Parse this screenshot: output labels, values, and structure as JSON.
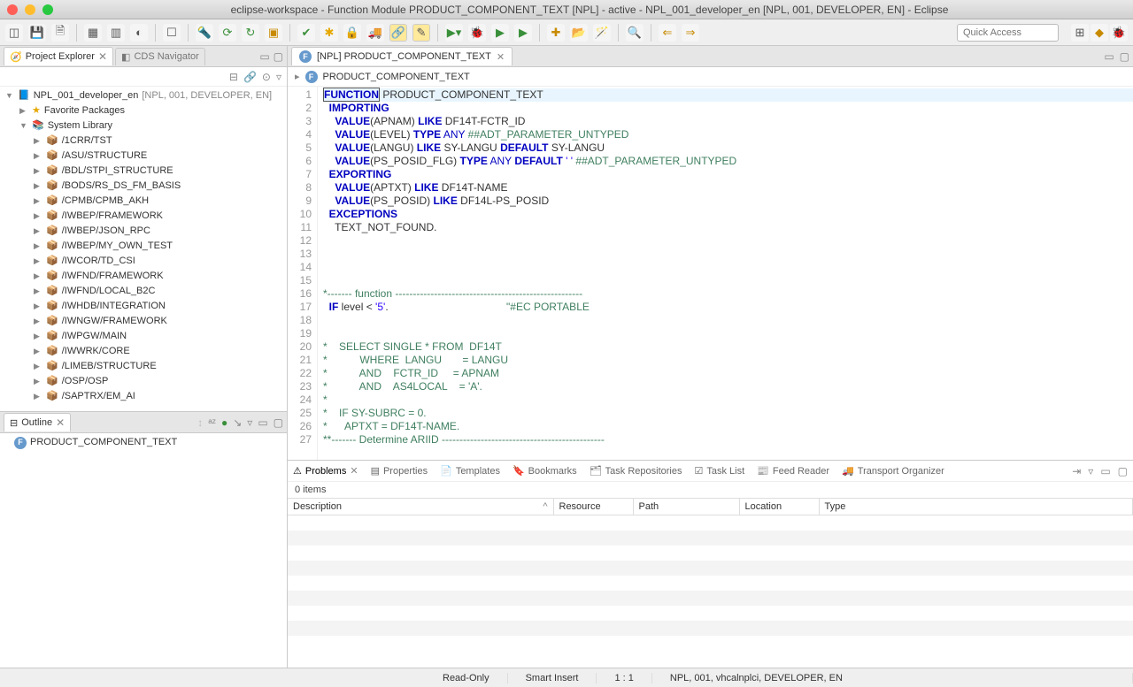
{
  "window_title": "eclipse-workspace - Function Module PRODUCT_COMPONENT_TEXT [NPL] - active - NPL_001_developer_en [NPL, 001, DEVELOPER, EN] - Eclipse",
  "quick_access_placeholder": "Quick Access",
  "views": {
    "project_explorer": "Project Explorer",
    "cds_navigator": "CDS Navigator",
    "outline": "Outline"
  },
  "tree": {
    "root": "NPL_001_developer_en",
    "root_suffix": "[NPL, 001, DEVELOPER, EN]",
    "favorite": "Favorite Packages",
    "syslib": "System Library",
    "packages": [
      "/1CRR/TST",
      "/ASU/STRUCTURE",
      "/BDL/STPI_STRUCTURE",
      "/BODS/RS_DS_FM_BASIS",
      "/CPMB/CPMB_AKH",
      "/IWBEP/FRAMEWORK",
      "/IWBEP/JSON_RPC",
      "/IWBEP/MY_OWN_TEST",
      "/IWCOR/TD_CSI",
      "/IWFND/FRAMEWORK",
      "/IWFND/LOCAL_B2C",
      "/IWHDB/INTEGRATION",
      "/IWNGW/FRAMEWORK",
      "/IWPGW/MAIN",
      "/IWWRK/CORE",
      "/LIMEB/STRUCTURE",
      "/OSP/OSP",
      "/SAPTRX/EM_AI"
    ]
  },
  "outline_item": "PRODUCT_COMPONENT_TEXT",
  "editor": {
    "tab": "[NPL] PRODUCT_COMPONENT_TEXT",
    "breadcrumb": "PRODUCT_COMPONENT_TEXT",
    "lines": [
      {
        "n": 1,
        "html": "<span class='hl'><span class='kw'>FUNCTION</span></span> PRODUCT_COMPONENT_TEXT"
      },
      {
        "n": 2,
        "html": "  <span class='kw'>IMPORTING</span>"
      },
      {
        "n": 3,
        "html": "    <span class='kw'>VALUE</span>(APNAM) <span class='kw'>LIKE</span> DF14T-FCTR_ID"
      },
      {
        "n": 4,
        "html": "    <span class='kw'>VALUE</span>(LEVEL) <span class='kw'>TYPE</span> <span class='ty'>ANY</span> <span class='cmt'>##ADT_PARAMETER_UNTYPED</span>"
      },
      {
        "n": 5,
        "html": "    <span class='kw'>VALUE</span>(LANGU) <span class='kw'>LIKE</span> SY-LANGU <span class='kw'>DEFAULT</span> SY-LANGU"
      },
      {
        "n": 6,
        "html": "    <span class='kw'>VALUE</span>(PS_POSID_FLG) <span class='kw'>TYPE</span> <span class='ty'>ANY</span> <span class='kw'>DEFAULT</span> <span class='str'>' '</span> <span class='cmt'>##ADT_PARAMETER_UNTYPED</span>"
      },
      {
        "n": 7,
        "html": "  <span class='kw'>EXPORTING</span>"
      },
      {
        "n": 8,
        "html": "    <span class='kw'>VALUE</span>(APTXT) <span class='kw'>LIKE</span> DF14T-NAME"
      },
      {
        "n": 9,
        "html": "    <span class='kw'>VALUE</span>(PS_POSID) <span class='kw'>LIKE</span> DF14L-PS_POSID"
      },
      {
        "n": 10,
        "html": "  <span class='kw'>EXCEPTIONS</span>"
      },
      {
        "n": 11,
        "html": "    TEXT_NOT_FOUND."
      },
      {
        "n": 12,
        "html": ""
      },
      {
        "n": 13,
        "html": ""
      },
      {
        "n": 14,
        "html": ""
      },
      {
        "n": 15,
        "html": ""
      },
      {
        "n": 16,
        "html": "<span class='cmt'>*------- function -----------------------------------------------------</span>"
      },
      {
        "n": 17,
        "html": "  <span class='kw'>IF</span> level &lt; <span class='str'>'5'</span>.                                        <span class='cmt'>\"#EC PORTABLE</span>"
      },
      {
        "n": 18,
        "html": ""
      },
      {
        "n": 19,
        "html": ""
      },
      {
        "n": 20,
        "html": "<span class='cmt'>*    SELECT SINGLE * FROM  DF14T</span>"
      },
      {
        "n": 21,
        "html": "<span class='cmt'>*           WHERE  LANGU       = LANGU</span>"
      },
      {
        "n": 22,
        "html": "<span class='cmt'>*           AND    FCTR_ID     = APNAM</span>"
      },
      {
        "n": 23,
        "html": "<span class='cmt'>*           AND    AS4LOCAL    = 'A'.</span>"
      },
      {
        "n": 24,
        "html": "<span class='cmt'>*</span>"
      },
      {
        "n": 25,
        "html": "<span class='cmt'>*    IF SY-SUBRC = 0.</span>"
      },
      {
        "n": 26,
        "html": "<span class='cmt'>*      APTXT = DF14T-NAME.</span>"
      },
      {
        "n": 27,
        "html": "<span class='cmt'>**------- Determine ARIID ----------------------------------------------</span>"
      }
    ]
  },
  "bottom_tabs": [
    "Problems",
    "Properties",
    "Templates",
    "Bookmarks",
    "Task Repositories",
    "Task List",
    "Feed Reader",
    "Transport Organizer"
  ],
  "problems_count": "0 items",
  "problems_cols": [
    "Description",
    "Resource",
    "Path",
    "Location",
    "Type"
  ],
  "status": {
    "readonly": "Read-Only",
    "insert": "Smart Insert",
    "pos": "1 : 1",
    "system": "NPL, 001, vhcalnplci, DEVELOPER, EN"
  },
  "bv_toolbar": "⇥"
}
